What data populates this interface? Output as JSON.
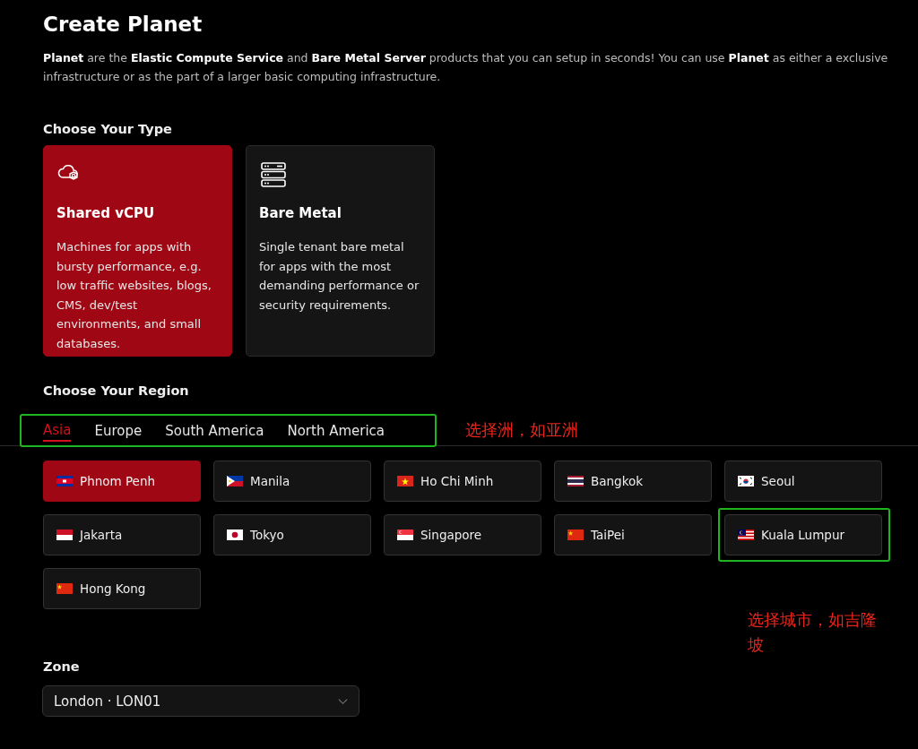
{
  "title": "Create Planet",
  "intro": "**Planet** are the **Elastic Compute Service** and **Bare Metal Server** products that you can setup in seconds! You can use **Planet** as either a exclusive infrastructure or as the part of a larger basic computing infrastructure.",
  "type_section": {
    "heading": "Choose Your Type",
    "types": [
      {
        "kind": "cloud",
        "name": "Shared vCPU",
        "description": "Machines for apps with bursty performance, e.g. low traffic websites, blogs, CMS, dev/test environments, and small databases.",
        "selected": true
      },
      {
        "kind": "server",
        "name": "Bare Metal",
        "description": "Single tenant bare metal for apps with the most demanding performance or security requirements.",
        "selected": false
      }
    ]
  },
  "region_section": {
    "heading": "Choose Your Region",
    "tabs_outlined": true,
    "tabs": [
      {
        "label": "Asia",
        "selected": true
      },
      {
        "label": "Europe",
        "selected": false
      },
      {
        "label": "South America",
        "selected": false
      },
      {
        "label": "North America",
        "selected": false
      }
    ],
    "cities": [
      {
        "name": "Phnom Penh",
        "kind": "kh",
        "selected": true,
        "outlined": false
      },
      {
        "name": "Manila",
        "kind": "ph",
        "selected": false,
        "outlined": false
      },
      {
        "name": "Ho Chi Minh",
        "kind": "vn",
        "selected": false,
        "outlined": false
      },
      {
        "name": "Bangkok",
        "kind": "th",
        "selected": false,
        "outlined": false
      },
      {
        "name": "Seoul",
        "kind": "kr",
        "selected": false,
        "outlined": false
      },
      {
        "name": "Jakarta",
        "kind": "id",
        "selected": false,
        "outlined": false
      },
      {
        "name": "Tokyo",
        "kind": "jp",
        "selected": false,
        "outlined": false
      },
      {
        "name": "Singapore",
        "kind": "sg",
        "selected": false,
        "outlined": false
      },
      {
        "name": "TaiPei",
        "kind": "cn",
        "selected": false,
        "outlined": false
      },
      {
        "name": "Kuala Lumpur",
        "kind": "my",
        "selected": false,
        "outlined": true
      },
      {
        "name": "Hong Kong",
        "kind": "cn",
        "selected": false,
        "outlined": false
      }
    ]
  },
  "zone": {
    "label": "Zone",
    "value": "London · LON01"
  },
  "annotations": [
    {
      "kind": "tabs",
      "text": "选择洲，如亚洲"
    },
    {
      "kind": "cities",
      "text": "选择城市，如吉隆坡"
    }
  ]
}
